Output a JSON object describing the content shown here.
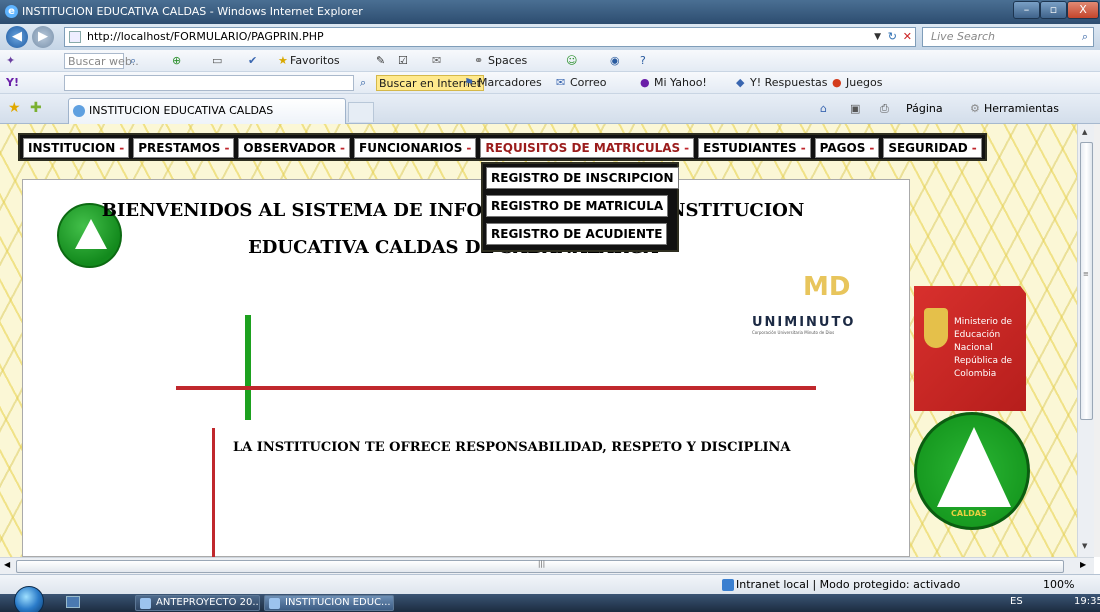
{
  "window": {
    "title": "INSTITUCION EDUCATIVA CALDAS - Windows Internet Explorer",
    "min": "–",
    "max": "▫",
    "close": "X"
  },
  "address": {
    "url": "http://localhost/FORMULARIO/PAGPRIN.PHP",
    "search_placeholder": "Live Search"
  },
  "toolbar1": {
    "search_placeholder": "Buscar web..",
    "favorites": "Favoritos",
    "spaces": "Spaces"
  },
  "toolbar2": {
    "search_button": "Buscar en Internet",
    "marcadores": "Marcadores",
    "correo": "Correo",
    "mi_yahoo": "Mi Yahoo!",
    "respuestas": "Y! Respuestas",
    "juegos": "Juegos"
  },
  "tab": {
    "label": "INSTITUCION EDUCATIVA CALDAS"
  },
  "commands": {
    "pagina": "Página",
    "herramientas": "Herramientas"
  },
  "menu": {
    "items": [
      "INSTITUCION",
      "PRESTAMOS",
      "OBSERVADOR",
      "FUNCIONARIOS",
      "REQUISITOS DE MATRICULAS",
      "ESTUDIANTES",
      "PAGOS",
      "SEGURIDAD"
    ],
    "dash": "-"
  },
  "dropdown": {
    "items": [
      "REGISTRO DE INSCRIPCION",
      "REGISTRO DE MATRICULA",
      "REGISTRO DE ACUDIENTE"
    ]
  },
  "page": {
    "welcome_line1": "BIENVENIDOS AL SISTEMA DE INFORMACION DE LA INSTITUCION",
    "welcome_line2": "EDUCATIVA CALDAS DE SABANALARGA",
    "tagline": "LA INSTITUCION TE OFRECE RESPONSABILIDAD, RESPETO Y DISCIPLINA"
  },
  "logos": {
    "uniminuto": "UNIMINUTO",
    "uniminuto_sub": "Corporación Universitaria Minuto de Dios",
    "md": "MD",
    "ministerio_l1": "Ministerio de",
    "ministerio_l2": "Educación Nacional",
    "ministerio_l3": "República de Colombia",
    "seal_word": "CALDAS"
  },
  "status": {
    "zone": "Intranet local | Modo protegido: activado",
    "zoom": "100%"
  },
  "taskbar": {
    "items": [
      "ANTEPROYECTO 20...",
      "INSTITUCION EDUC..."
    ],
    "lang": "ES",
    "time": "19:35"
  }
}
